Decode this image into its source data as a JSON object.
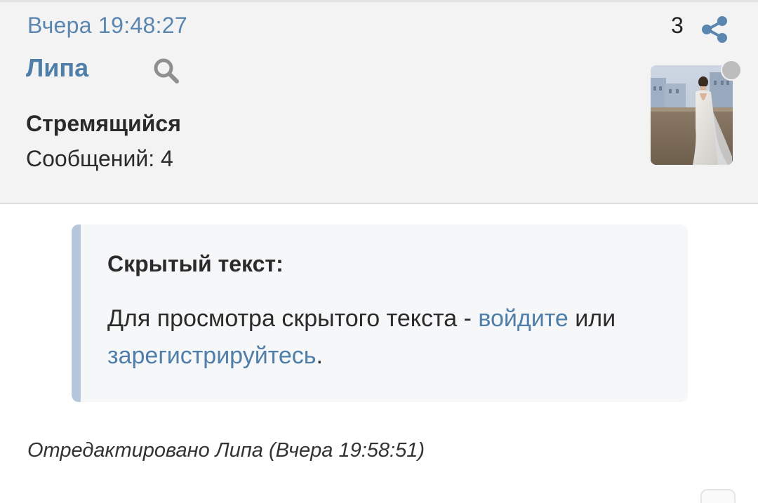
{
  "post": {
    "timestamp": "Вчера 19:48:27",
    "number": "3",
    "author": "Липа",
    "rank": "Стремящийся",
    "messages": "Сообщений: 4",
    "edited_note": "Отредактировано Липа (Вчера 19:58:51)"
  },
  "spoiler": {
    "title": "Скрытый текст:",
    "text_before": "Для просмотра скрытого текста - ",
    "login_link": "войдите",
    "text_middle": " или ",
    "register_link": "зарегистрируйтесь",
    "text_after": "."
  },
  "icons": {
    "share": "share-icon",
    "search": "search-icon",
    "status": "offline-status-dot"
  },
  "colors": {
    "accent": "#4f7ea9",
    "timestamp": "#5b86b0",
    "header_bg": "#f3f3f3",
    "spoiler_bar": "#b6c7dd",
    "status_dot": "#bdbdbd"
  }
}
